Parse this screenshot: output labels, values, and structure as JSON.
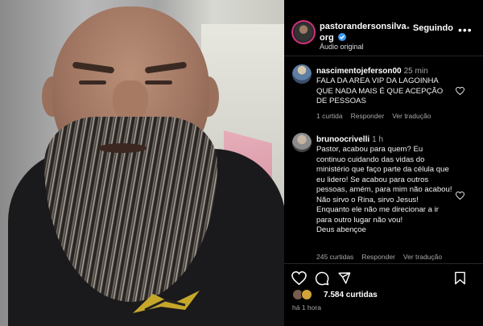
{
  "post": {
    "username": "pastorandersonsilva org",
    "follow_label": "Seguindo",
    "more_label": "•••",
    "audio_label": "Áudio original",
    "likes": "7.584 curtidas",
    "time_ago": "há 1 hora"
  },
  "comments": [
    {
      "user": "nascimentojeferson00",
      "time": "25 min",
      "text": "FALA DA AREA VIP DA LAGOINHA QUE NADA MAIS É QUE ACEPÇÃO DE PESSOAS",
      "likes": "1 curtida",
      "reply": "Responder",
      "translate": "Ver tradução"
    },
    {
      "user": "brunoocrivelli",
      "time": "1 h",
      "text": "Pastor, acabou para quem? Eu continuo cuidando das vidas do ministério que faço parte da célula que eu lidero! Se acabou para outros pessoas, amém, para mim não acabou! Não sirvo o Rina, sirvo Jesus! Enquanto ele não me direcionar a ir para outro lugar não vou!",
      "text2": "Deus abençoe",
      "likes": "245 curtidas",
      "reply": "Responder",
      "translate": "Ver tradução"
    }
  ],
  "icons": [
    "verified-badge-icon",
    "more-options-icon",
    "heart-icon",
    "comment-icon",
    "share-icon",
    "bookmark-icon"
  ],
  "colors": {
    "verified": "#3897f0",
    "story_ring": "#d12f7d",
    "muted": "#a8a8a8"
  }
}
